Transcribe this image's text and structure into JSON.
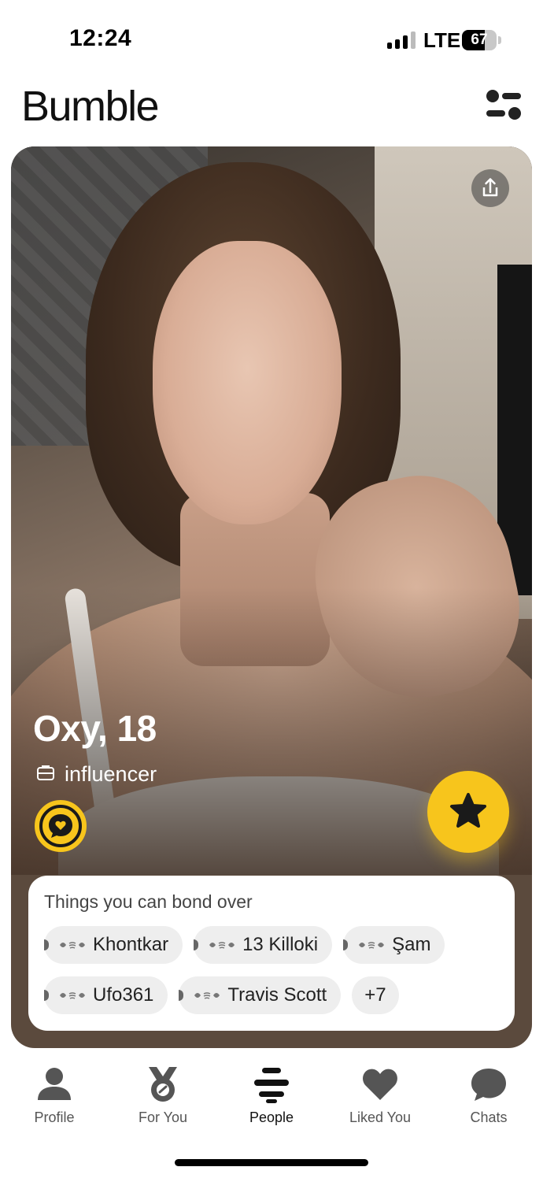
{
  "status_bar": {
    "time": "12:24",
    "network": "LTE",
    "battery": "67",
    "battery_level": 0.67
  },
  "header": {
    "logo": "Bumble",
    "filter_icon": "filter-settings-icon"
  },
  "profile": {
    "name_age": "Oxy, 18",
    "job_icon": "briefcase-icon",
    "job": "influencer",
    "share_icon": "share-icon",
    "bond_icon": "chat-heart-icon",
    "superswipe_icon": "star-icon"
  },
  "bond": {
    "title": "Things you can bond over",
    "chips": [
      "Khontkar",
      "13 Killoki",
      "Şam",
      "Ufo361",
      "Travis Scott",
      "+7"
    ]
  },
  "nav": [
    {
      "label": "Profile",
      "icon": "person-icon"
    },
    {
      "label": "For You",
      "icon": "medal-icon"
    },
    {
      "label": "People",
      "icon": "stack-icon"
    },
    {
      "label": "Liked You",
      "icon": "heart-icon"
    },
    {
      "label": "Chats",
      "icon": "chat-bubble-icon"
    }
  ],
  "colors": {
    "accent": "#f7c51c",
    "card_bottom": "#5b4a3d"
  }
}
